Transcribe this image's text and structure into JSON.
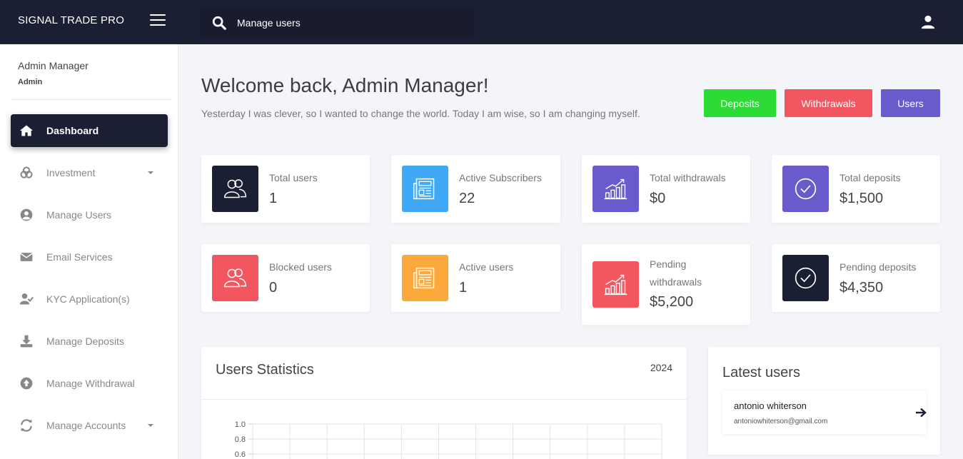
{
  "topbar": {
    "brand": "SIGNAL TRADE PRO",
    "search_value": "Manage users"
  },
  "sidebar": {
    "user_name": "Admin Manager",
    "user_role": "Admin",
    "items": [
      {
        "label": "Dashboard",
        "icon": "home-icon",
        "active": true
      },
      {
        "label": "Investment",
        "icon": "coins-icon",
        "has_caret": true
      },
      {
        "label": "Manage Users",
        "icon": "user-circle-icon"
      },
      {
        "label": "Email Services",
        "icon": "envelope-icon"
      },
      {
        "label": "KYC Application(s)",
        "icon": "user-check-icon"
      },
      {
        "label": "Manage Deposits",
        "icon": "download-icon"
      },
      {
        "label": "Manage Withdrawal",
        "icon": "arrow-up-circle-icon"
      },
      {
        "label": "Manage Accounts",
        "icon": "refresh-icon",
        "has_caret": true
      }
    ]
  },
  "main": {
    "welcome": "Welcome back, Admin Manager!",
    "quote": "Yesterday I was clever, so I wanted to change the world. Today I am wise, so I am changing myself.",
    "buttons": [
      {
        "label": "Deposits",
        "color": "#2ddb36"
      },
      {
        "label": "Withdrawals",
        "color": "#f2575f"
      },
      {
        "label": "Users",
        "color": "#6a5bcc"
      }
    ],
    "stats": [
      {
        "label": "Total users",
        "value": "1",
        "color": "#1b1f33",
        "icon": "users-icon"
      },
      {
        "label": "Active Subscribers",
        "value": "22",
        "color": "#3fa9f5",
        "icon": "newspaper-icon"
      },
      {
        "label": "Total withdrawals",
        "value": "$0",
        "color": "#6a5bcc",
        "icon": "chart-up-icon"
      },
      {
        "label": "Total deposits",
        "value": "$1,500",
        "color": "#6a5bcc",
        "icon": "check-circle-icon"
      },
      {
        "label": "Blocked users",
        "value": "0",
        "color": "#f2575f",
        "icon": "users-icon"
      },
      {
        "label": "Active users",
        "value": "1",
        "color": "#fba93b",
        "icon": "newspaper-icon"
      },
      {
        "label": "Pending withdrawals",
        "value": "$5,200",
        "color": "#f2575f",
        "icon": "chart-up-icon"
      },
      {
        "label": "Pending deposits",
        "value": "$4,350",
        "color": "#1b1f33",
        "icon": "check-circle-icon"
      }
    ],
    "user_statistics": {
      "title": "Users Statistics",
      "year": "2024"
    },
    "latest_users": {
      "title": "Latest users",
      "items": [
        {
          "name": "antonio whiterson",
          "email": "antoniowhiterson@gmail.com"
        }
      ]
    }
  },
  "chart_data": {
    "type": "line",
    "title": "",
    "yticks": [
      "1.0",
      "0.8",
      "0.6"
    ],
    "ylim": [
      0,
      1.0
    ],
    "grid": true,
    "series": []
  }
}
